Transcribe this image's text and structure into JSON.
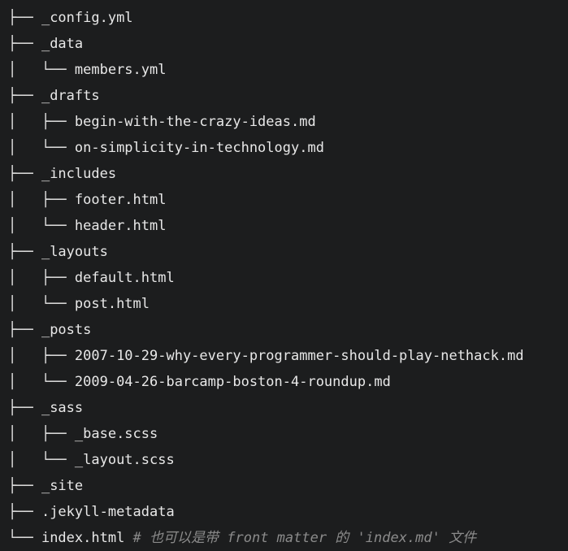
{
  "terminal": {
    "background_color": "#1c1d1e",
    "text_color": "#e8e8e8",
    "comment_color": "#8b8b8b",
    "rows": [
      {
        "prefix": "├── ",
        "name": "_config.yml",
        "comment": ""
      },
      {
        "prefix": "├── ",
        "name": "_data",
        "comment": ""
      },
      {
        "prefix": "│   └── ",
        "name": "members.yml",
        "comment": ""
      },
      {
        "prefix": "├── ",
        "name": "_drafts",
        "comment": ""
      },
      {
        "prefix": "│   ├── ",
        "name": "begin-with-the-crazy-ideas.md",
        "comment": ""
      },
      {
        "prefix": "│   └── ",
        "name": "on-simplicity-in-technology.md",
        "comment": ""
      },
      {
        "prefix": "├── ",
        "name": "_includes",
        "comment": ""
      },
      {
        "prefix": "│   ├── ",
        "name": "footer.html",
        "comment": ""
      },
      {
        "prefix": "│   └── ",
        "name": "header.html",
        "comment": ""
      },
      {
        "prefix": "├── ",
        "name": "_layouts",
        "comment": ""
      },
      {
        "prefix": "│   ├── ",
        "name": "default.html",
        "comment": ""
      },
      {
        "prefix": "│   └── ",
        "name": "post.html",
        "comment": ""
      },
      {
        "prefix": "├── ",
        "name": "_posts",
        "comment": ""
      },
      {
        "prefix": "│   ├── ",
        "name": "2007-10-29-why-every-programmer-should-play-nethack.md",
        "comment": ""
      },
      {
        "prefix": "│   └── ",
        "name": "2009-04-26-barcamp-boston-4-roundup.md",
        "comment": ""
      },
      {
        "prefix": "├── ",
        "name": "_sass",
        "comment": ""
      },
      {
        "prefix": "│   ├── ",
        "name": "_base.scss",
        "comment": ""
      },
      {
        "prefix": "│   └── ",
        "name": "_layout.scss",
        "comment": ""
      },
      {
        "prefix": "├── ",
        "name": "_site",
        "comment": ""
      },
      {
        "prefix": "├── ",
        "name": ".jekyll-metadata",
        "comment": ""
      },
      {
        "prefix": "└── ",
        "name": "index.html",
        "comment": " # 也可以是带 front matter 的 'index.md' 文件"
      }
    ]
  }
}
